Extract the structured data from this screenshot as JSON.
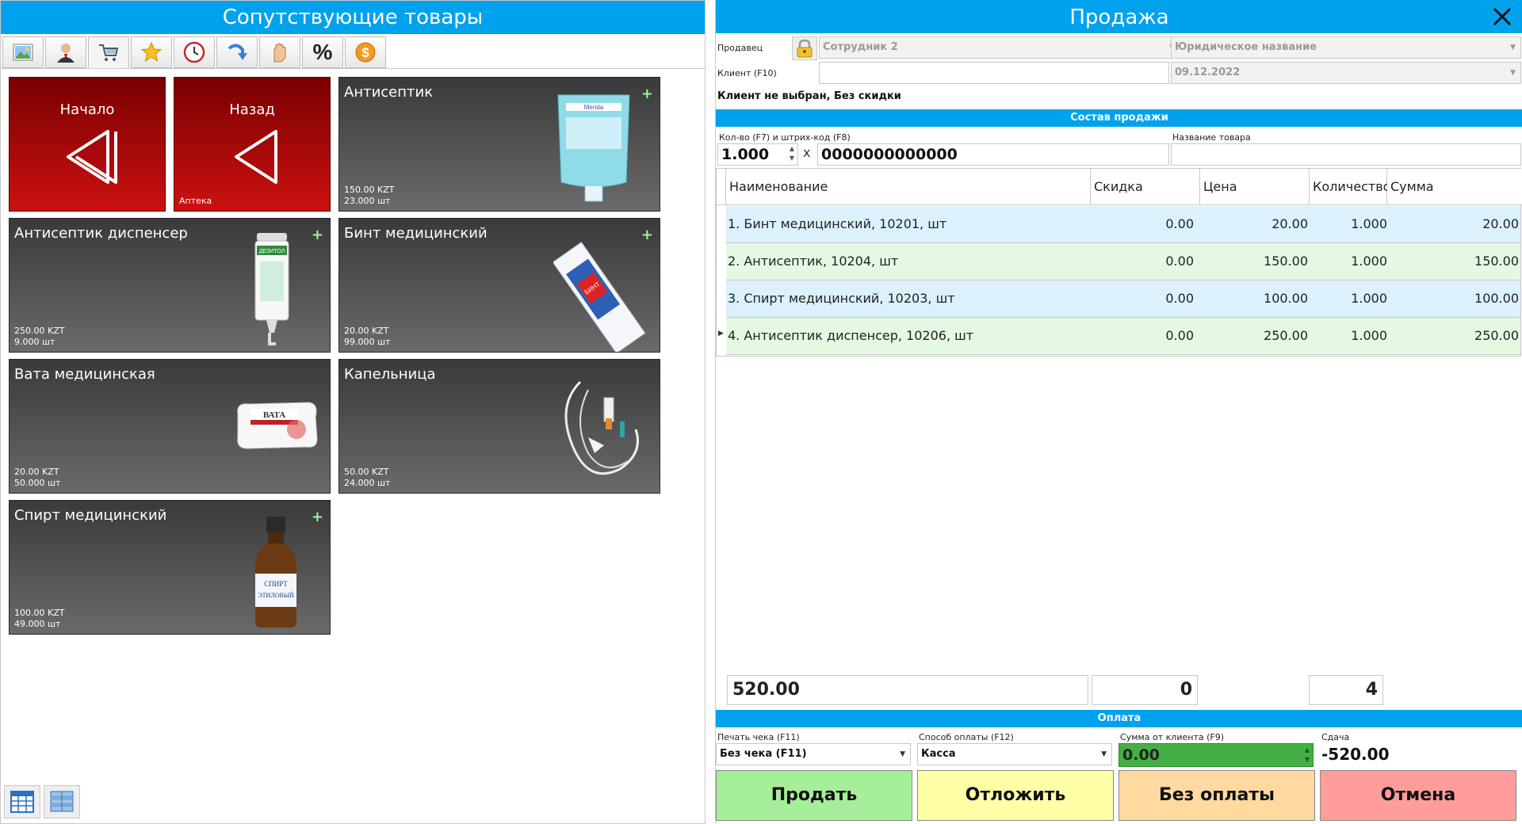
{
  "left": {
    "title": "Сопутствующие товары",
    "toolbar": [
      {
        "icon": "picture-icon"
      },
      {
        "icon": "user-icon"
      },
      {
        "icon": "cart-icon"
      },
      {
        "icon": "star-icon"
      },
      {
        "icon": "clock-icon"
      },
      {
        "icon": "arrow-return-icon"
      },
      {
        "icon": "hand-icon"
      },
      {
        "icon": "percent-icon",
        "label": "%"
      },
      {
        "icon": "dollar-coin-icon",
        "label": "$"
      }
    ],
    "tiles": {
      "home": {
        "label": "Начало"
      },
      "back": {
        "label": "Назад",
        "sub": "Аптека"
      },
      "products": [
        {
          "name": "Антисептик",
          "price": "150.00 KZT",
          "stock": "23.000 шт",
          "plus": "+"
        },
        {
          "name": "Антисептик диспенсер",
          "price": "250.00 KZT",
          "stock": "9.000 шт",
          "plus": "+"
        },
        {
          "name": "Бинт медицинский",
          "price": "20.00 KZT",
          "stock": "99.000 шт",
          "plus": "+"
        },
        {
          "name": "Вата медицинская",
          "price": "20.00 KZT",
          "stock": "50.000 шт",
          "plus": ""
        },
        {
          "name": "Капельница",
          "price": "50.00 KZT",
          "stock": "24.000 шт",
          "plus": ""
        },
        {
          "name": "Спирт медицинский",
          "price": "100.00 KZT",
          "stock": "49.000 шт",
          "plus": "+"
        }
      ],
      "product_images": {
        "antiseptic_bag_text": "Merida",
        "dispenser_text": "ДЕЗИТОЛ",
        "bandage_text": "БИНТ",
        "cotton_text": "ВАТА",
        "alcohol_text1": "СПИРТ",
        "alcohol_text2": "ЭТИЛОВЫЙ"
      }
    }
  },
  "right": {
    "title": "Продажа",
    "seller_label": "Продавец",
    "seller_value": "Сотрудник 2",
    "legal_name_placeholder": "Юридическое название",
    "client_label": "Клиент (F10)",
    "client_value": "",
    "date_value": "09.12.2022",
    "client_status": "Клиент не выбран, Без скидки",
    "section_sale": "Состав продажи",
    "qty_label": "Кол-во (F7) и штрих-код (F8)",
    "qty_value": "1.000",
    "times": "x",
    "barcode_value": "0000000000000",
    "product_name_label": "Название товара",
    "product_name_value": "",
    "columns": [
      "Наименование",
      "Скидка",
      "Цена",
      "Количество",
      "Сумма"
    ],
    "rows": [
      {
        "name": "1. Бинт медицинский, 10201, шт",
        "discount": "0.00",
        "price": "20.00",
        "qty": "1.000",
        "sum": "20.00"
      },
      {
        "name": "2. Антисептик, 10204, шт",
        "discount": "0.00",
        "price": "150.00",
        "qty": "1.000",
        "sum": "150.00"
      },
      {
        "name": "3. Спирт медицинский, 10203, шт",
        "discount": "0.00",
        "price": "100.00",
        "qty": "1.000",
        "sum": "100.00"
      },
      {
        "name": "4. Антисептик диспенсер, 10206, шт",
        "discount": "0.00",
        "price": "250.00",
        "qty": "1.000",
        "sum": "250.00"
      }
    ],
    "totals": {
      "sum": "520.00",
      "discount": "0",
      "count": "4"
    },
    "section_payment": "Оплата",
    "receipt_label": "Печать чека (F11)",
    "receipt_value": "Без чека (F11)",
    "paymethod_label": "Способ оплаты (F12)",
    "paymethod_value": "Касса",
    "client_sum_label": "Сумма от клиента (F9)",
    "client_sum_value": "0.00",
    "change_label": "Сдача",
    "change_value": "-520.00",
    "buttons": {
      "sell": "Продать",
      "postpone": "Отложить",
      "no_payment": "Без оплаты",
      "cancel": "Отмена"
    },
    "colors": {
      "accent": "#00a2ed",
      "sell": "#a6ee9a",
      "postpone": "#ffffa8",
      "no_payment": "#ffd9a0",
      "cancel": "#ff9d9d",
      "client_sum": "#44b044"
    }
  }
}
